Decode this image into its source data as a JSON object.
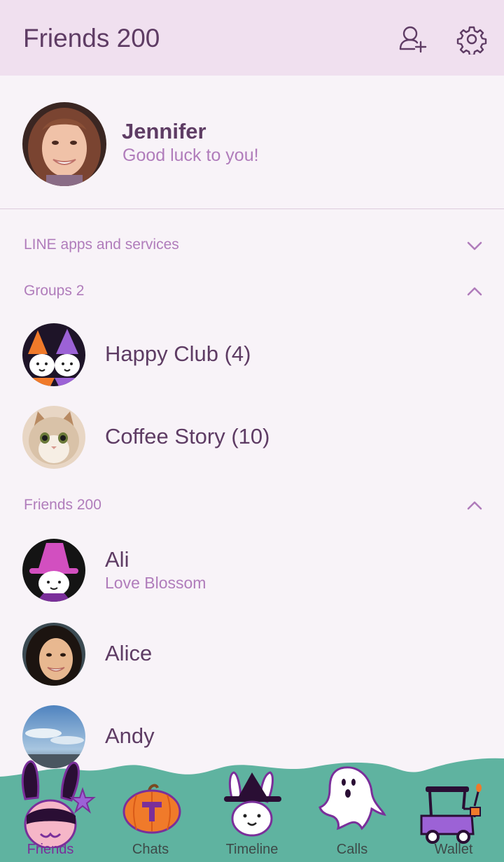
{
  "header": {
    "title": "Friends 200",
    "add_friend_icon": "add-friend-icon",
    "settings_icon": "gear-icon"
  },
  "profile": {
    "name": "Jennifer",
    "status": "Good luck to you!"
  },
  "sections": {
    "line_apps": {
      "label": "LINE apps and services",
      "expanded": false
    },
    "groups": {
      "label": "Groups 2",
      "expanded": true
    },
    "friends": {
      "label": "Friends 200",
      "expanded": true
    }
  },
  "groups": [
    {
      "name": "Happy Club (4)"
    },
    {
      "name": "Coffee Story (10)"
    }
  ],
  "friends": [
    {
      "name": "Ali",
      "status": "Love Blossom"
    },
    {
      "name": "Alice",
      "status": ""
    },
    {
      "name": "Andy",
      "status": ""
    }
  ],
  "tabs": [
    {
      "label": "Friends",
      "icon": "bunny-mask-icon",
      "active": true
    },
    {
      "label": "Chats",
      "icon": "pumpkin-icon",
      "active": false
    },
    {
      "label": "Timeline",
      "icon": "witch-bunny-icon",
      "active": false
    },
    {
      "label": "Calls",
      "icon": "ghost-icon",
      "active": false
    },
    {
      "label": "Wallet",
      "icon": "golf-cart-icon",
      "active": false
    }
  ],
  "colors": {
    "header_bg": "#f0e0ef",
    "page_bg": "#f8f3f8",
    "text_primary": "#5e3c64",
    "text_secondary": "#b07cbb",
    "tabbar_green": "#5fb3a0",
    "active_tab": "#7a2f9a"
  }
}
